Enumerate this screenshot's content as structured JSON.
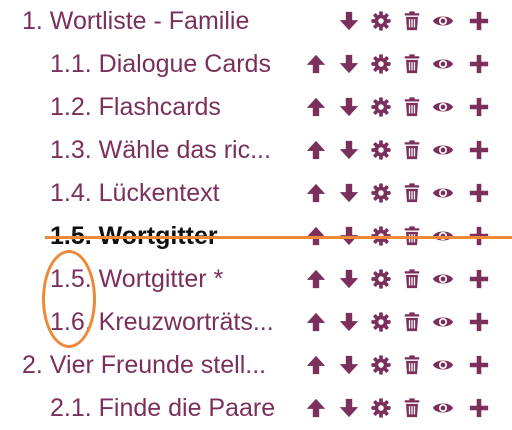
{
  "colors": {
    "text": "#7b2f5b",
    "icon": "#7b2f5b",
    "annotation": "#ed8938"
  },
  "tree": {
    "items": [
      {
        "label": "1. Wortliste - Familie",
        "level": 0,
        "bold": false,
        "icons": [
          "arrow-down-icon",
          "gear-icon",
          "trash-icon",
          "eye-icon",
          "plus-icon"
        ]
      },
      {
        "label": "1.1. Dialogue Cards",
        "level": 1,
        "bold": false,
        "icons": [
          "arrow-up-icon",
          "arrow-down-icon",
          "gear-icon",
          "trash-icon",
          "eye-icon",
          "plus-icon"
        ]
      },
      {
        "label": "1.2. Flashcards",
        "level": 1,
        "bold": false,
        "icons": [
          "arrow-up-icon",
          "arrow-down-icon",
          "gear-icon",
          "trash-icon",
          "eye-icon",
          "plus-icon"
        ]
      },
      {
        "label": "1.3. Wähle das ric...",
        "level": 1,
        "bold": false,
        "icons": [
          "arrow-up-icon",
          "arrow-down-icon",
          "gear-icon",
          "trash-icon",
          "eye-icon",
          "plus-icon"
        ]
      },
      {
        "label": "1.4. Lückentext",
        "level": 1,
        "bold": false,
        "icons": [
          "arrow-up-icon",
          "arrow-down-icon",
          "gear-icon",
          "trash-icon",
          "eye-icon",
          "plus-icon"
        ]
      },
      {
        "label": "1.5. Wortgitter",
        "level": 1,
        "bold": true,
        "struck": true,
        "icons": [
          "arrow-up-icon",
          "arrow-down-icon",
          "gear-icon",
          "trash-icon",
          "eye-icon",
          "plus-icon"
        ]
      },
      {
        "label": "1.5. Wortgitter *",
        "level": 1,
        "bold": false,
        "icons": [
          "arrow-up-icon",
          "arrow-down-icon",
          "gear-icon",
          "trash-icon",
          "eye-icon",
          "plus-icon"
        ]
      },
      {
        "label": "1.6. Kreuzworträts...",
        "level": 1,
        "bold": false,
        "icons": [
          "arrow-up-icon",
          "arrow-down-icon",
          "gear-icon",
          "trash-icon",
          "eye-icon",
          "plus-icon"
        ]
      },
      {
        "label": "2. Vier Freunde stell...",
        "level": 0,
        "bold": false,
        "icons": [
          "arrow-up-icon",
          "arrow-down-icon",
          "gear-icon",
          "trash-icon",
          "eye-icon",
          "plus-icon"
        ]
      },
      {
        "label": "2.1. Finde die Paare",
        "level": 1,
        "bold": false,
        "icons": [
          "arrow-up-icon",
          "arrow-down-icon",
          "gear-icon",
          "trash-icon",
          "eye-icon",
          "plus-icon"
        ]
      }
    ]
  }
}
